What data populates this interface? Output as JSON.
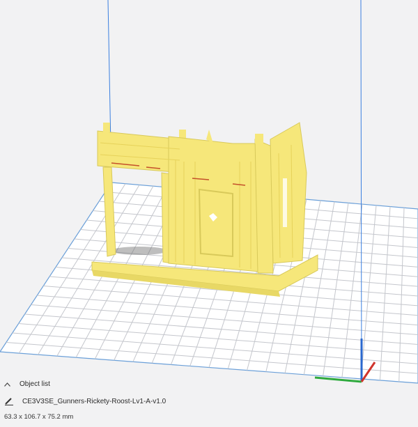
{
  "object_list": {
    "toggle_icon": "chevron-up-icon",
    "title": "Object list",
    "edit_icon": "pencil-icon",
    "filename": "CE3V3SE_Gunners-Rickety-Roost-Lv1-A-v1.0",
    "dimensions": "63.3 x 106.7 x 75.2 mm"
  },
  "colors": {
    "background": "#f2f2f3",
    "build_plate": "#ffffff",
    "grid_line": "#c4c6cc",
    "plate_border": "#6a9fd8",
    "model": "#f6e77a",
    "model_shadow": "#d8c95a",
    "axis_x": "#d0342c",
    "axis_y": "#2faa3e",
    "axis_z": "#2a68cf",
    "guide_line": "#3a7fe0"
  }
}
